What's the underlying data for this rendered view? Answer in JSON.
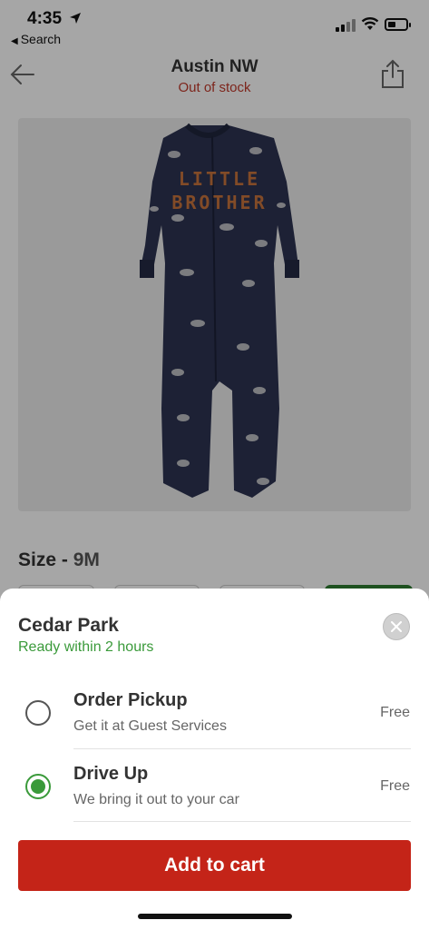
{
  "status_bar": {
    "time": "4:35",
    "back_app": "Search",
    "battery_level": 0.45
  },
  "header": {
    "store_name": "Austin NW",
    "stock_status": "Out of stock"
  },
  "product": {
    "image_print_text_line1": "LITTLE",
    "image_print_text_line2": "BROTHER"
  },
  "size": {
    "label": "Size",
    "separator": " - ",
    "value": "9M"
  },
  "sheet": {
    "store_name": "Cedar Park",
    "ready_text": "Ready within 2 hours",
    "options": [
      {
        "title": "Order Pickup",
        "subtitle": "Get it at Guest Services",
        "price": "Free",
        "selected": false
      },
      {
        "title": "Drive Up",
        "subtitle": "We bring it out to your car",
        "price": "Free",
        "selected": true
      }
    ],
    "add_to_cart": "Add to cart"
  },
  "colors": {
    "accent_red": "#c42418",
    "ready_green": "#3a9a3a",
    "out_of_stock": "#c0392b"
  },
  "icons": {
    "back": "arrow-left-icon",
    "share": "share-icon",
    "close": "close-icon",
    "location": "location-arrow-icon"
  }
}
